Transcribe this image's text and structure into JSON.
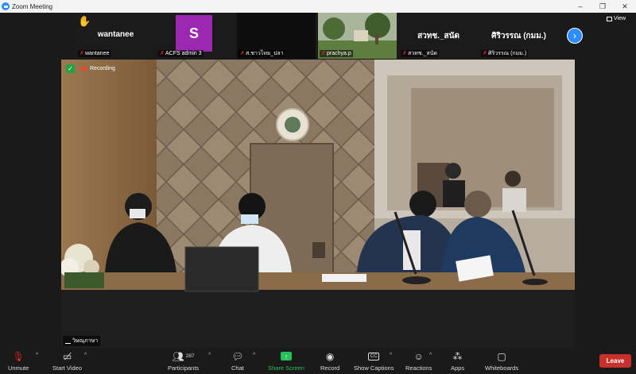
{
  "window": {
    "title": "Zoom Meeting",
    "controls": [
      "–",
      "❐",
      "✕"
    ]
  },
  "gallery": {
    "view_label": "View",
    "tiles": [
      {
        "display_name": "wantanee",
        "label": "wantanee",
        "raised_hand": true
      },
      {
        "avatar_letter": "S",
        "avatar_color": "#9c27b0",
        "label": "ACFS admin 3"
      },
      {
        "label": "ส.ชาวไทย_ปลา",
        "type": "video"
      },
      {
        "label": "prachya.p",
        "type": "video"
      },
      {
        "display_name": "สวทช._สนัด",
        "label": "สวทช._สนัด"
      },
      {
        "display_name": "ศิริวรรณ (กมม.)",
        "label": "ศิริวรรณ (กมม.)"
      }
    ]
  },
  "main_video": {
    "recording_label": "Recording",
    "active_speaker": "วิษณุภาษา"
  },
  "toolbar": {
    "unmute": "Unmute",
    "start_video": "Start Video",
    "participants": "Participants",
    "participant_count": "287",
    "chat": "Chat",
    "share_screen": "Share Screen",
    "record": "Record",
    "show_captions": "Show Captions",
    "reactions": "Reactions",
    "apps": "Apps",
    "whiteboards": "Whiteboards",
    "leave": "Leave"
  },
  "colors": {
    "accent": "#2d8cff",
    "share_green": "#25c05a",
    "leave_red": "#c8302c",
    "muted_mic_red": "#e02828",
    "security_green": "#25a244"
  }
}
